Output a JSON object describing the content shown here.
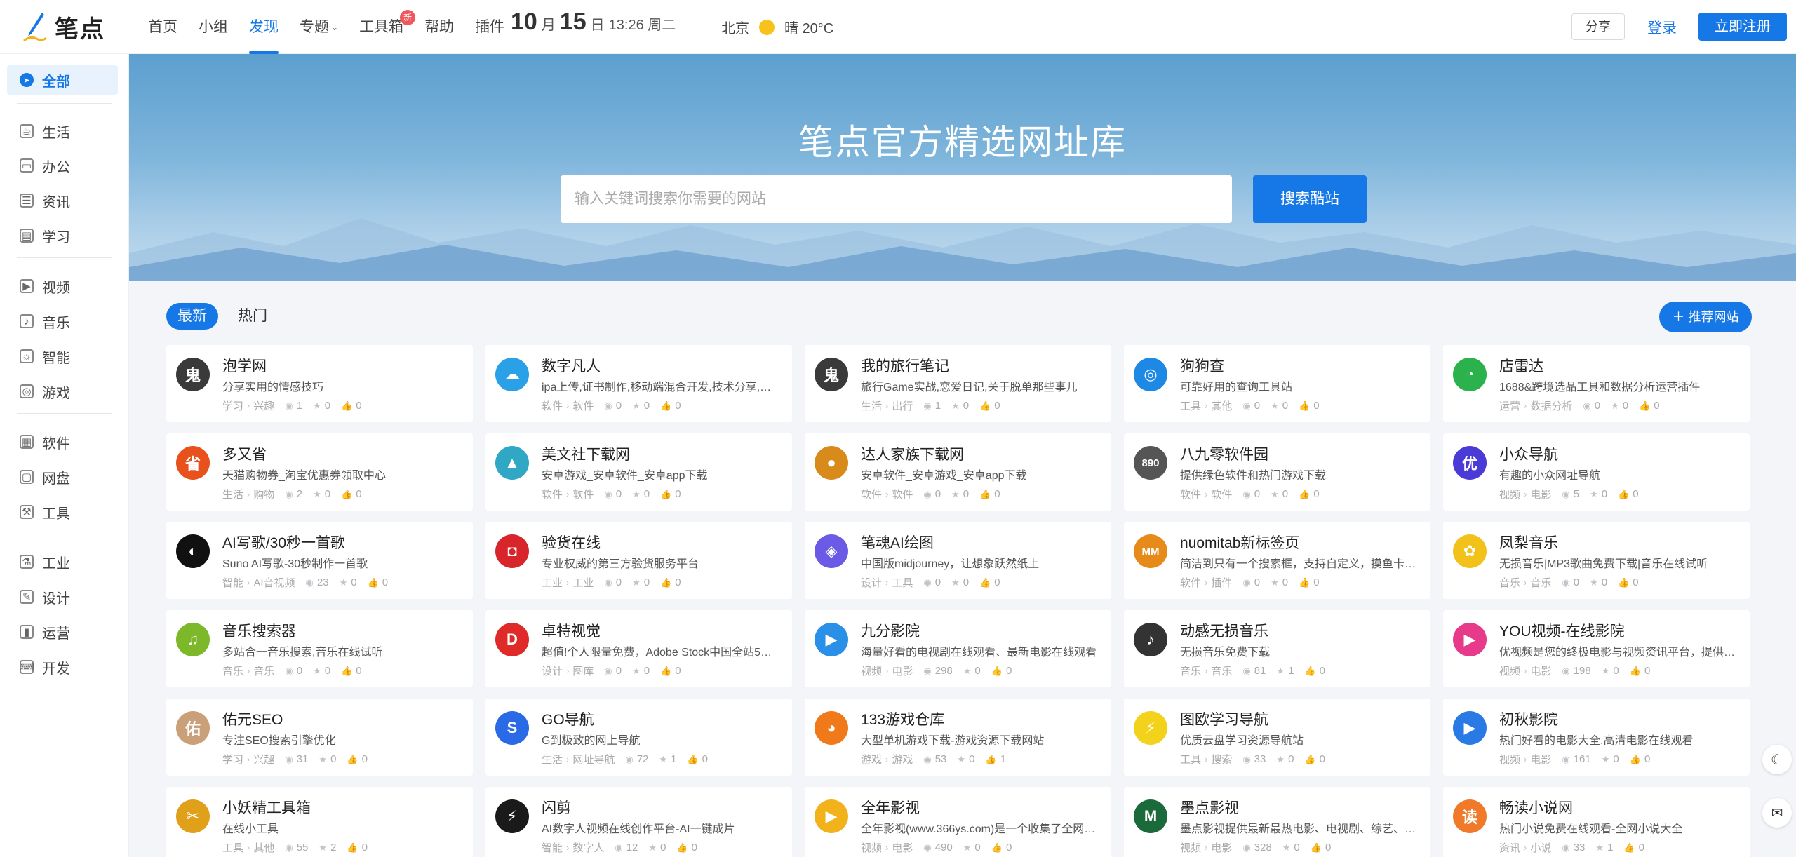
{
  "brand": {
    "name": "笔点"
  },
  "nav": [
    {
      "label": "首页",
      "active": false
    },
    {
      "label": "小组",
      "active": false
    },
    {
      "label": "发现",
      "active": true
    },
    {
      "label": "专题",
      "active": false,
      "caret": true
    },
    {
      "label": "工具箱",
      "active": false,
      "badge": "新"
    },
    {
      "label": "帮助",
      "active": false
    },
    {
      "label": "插件",
      "active": false
    }
  ],
  "date": {
    "month": "10",
    "month_label": "月",
    "day": "15",
    "day_label": "日",
    "rest": "13:26 周二"
  },
  "weather": {
    "city": "北京",
    "text": "晴 20°C"
  },
  "header_actions": {
    "share": "分享",
    "login": "登录",
    "register": "立即注册"
  },
  "sidebar": [
    {
      "label": "全部",
      "icon": "compass-icon",
      "active": true
    },
    {
      "label": "生活",
      "icon": "cup-icon"
    },
    {
      "label": "办公",
      "icon": "briefcase-icon"
    },
    {
      "label": "资讯",
      "icon": "news-icon"
    },
    {
      "label": "学习",
      "icon": "book-icon"
    },
    {
      "label": "视频",
      "icon": "video-icon"
    },
    {
      "label": "音乐",
      "icon": "music-icon"
    },
    {
      "label": "智能",
      "icon": "bulb-icon"
    },
    {
      "label": "游戏",
      "icon": "gamepad-icon"
    },
    {
      "label": "软件",
      "icon": "apps-icon"
    },
    {
      "label": "网盘",
      "icon": "folder-icon"
    },
    {
      "label": "工具",
      "icon": "hammer-icon"
    },
    {
      "label": "工业",
      "icon": "flask-icon"
    },
    {
      "label": "设计",
      "icon": "design-icon"
    },
    {
      "label": "运营",
      "icon": "chart-icon"
    },
    {
      "label": "开发",
      "icon": "code-icon"
    }
  ],
  "hero": {
    "title": "笔点官方精选网址库",
    "search_placeholder": "输入关键词搜索你需要的网站",
    "search_button": "搜索酷站"
  },
  "tabs": [
    {
      "label": "最新",
      "active": true
    },
    {
      "label": "热门",
      "active": false
    }
  ],
  "recommend_button": "＋ 推荐网站",
  "cards": [
    {
      "title": "泡学网",
      "desc": "分享实用的情感技巧",
      "cat": "学习",
      "sub": "兴趣",
      "views": "1",
      "stars": "0",
      "likes": "0",
      "logo_text": "鬼",
      "logo_color": "#3a3a3a"
    },
    {
      "title": "数字凡人",
      "desc": "ipa上传,证书制作,移动端混合开发,技术分享,…",
      "cat": "软件",
      "sub": "软件",
      "views": "0",
      "stars": "0",
      "likes": "0",
      "logo_text": "☁",
      "logo_color": "#2aa0e6"
    },
    {
      "title": "我的旅行笔记",
      "desc": "旅行Game实战,恋爱日记,关于脱单那些事儿",
      "cat": "生活",
      "sub": "出行",
      "views": "1",
      "stars": "0",
      "likes": "0",
      "logo_text": "鬼",
      "logo_color": "#3a3a3a"
    },
    {
      "title": "狗狗查",
      "desc": "可靠好用的查询工具站",
      "cat": "工具",
      "sub": "其他",
      "views": "0",
      "stars": "0",
      "likes": "0",
      "logo_text": "◎",
      "logo_color": "#1e88e5"
    },
    {
      "title": "店雷达",
      "desc": "1688&跨境选品工具和数据分析运营插件",
      "cat": "运营",
      "sub": "数据分析",
      "views": "0",
      "stars": "0",
      "likes": "0",
      "logo_text": "◔",
      "logo_color": "#2bb24c"
    },
    {
      "title": "多又省",
      "desc": "天猫购物券_淘宝优惠券领取中心",
      "cat": "生活",
      "sub": "购物",
      "views": "2",
      "stars": "0",
      "likes": "0",
      "logo_text": "省",
      "logo_color": "#e8511c"
    },
    {
      "title": "美文社下载网",
      "desc": "安卓游戏_安卓软件_安卓app下载",
      "cat": "软件",
      "sub": "软件",
      "views": "0",
      "stars": "0",
      "likes": "0",
      "logo_text": "▲",
      "logo_color": "#30a7c4"
    },
    {
      "title": "达人家族下载网",
      "desc": "安卓软件_安卓游戏_安卓app下载",
      "cat": "软件",
      "sub": "软件",
      "views": "0",
      "stars": "0",
      "likes": "0",
      "logo_text": "●",
      "logo_color": "#d88a1a"
    },
    {
      "title": "八九零软件园",
      "desc": "提供绿色软件和热门游戏下载",
      "cat": "软件",
      "sub": "软件",
      "views": "0",
      "stars": "0",
      "likes": "0",
      "logo_text": "890",
      "logo_color": "#555555"
    },
    {
      "title": "小众导航",
      "desc": "有趣的小众网址导航",
      "cat": "视频",
      "sub": "电影",
      "views": "5",
      "stars": "0",
      "likes": "0",
      "logo_text": "优",
      "logo_color": "#4a3ad6"
    },
    {
      "title": "AI写歌/30秒一首歌",
      "desc": "Suno AI写歌-30秒制作一首歌",
      "cat": "智能",
      "sub": "AI音视频",
      "views": "23",
      "stars": "0",
      "likes": "0",
      "logo_text": "◐",
      "logo_color": "#111111"
    },
    {
      "title": "验货在线",
      "desc": "专业权威的第三方验货服务平台",
      "cat": "工业",
      "sub": "工业",
      "views": "0",
      "stars": "0",
      "likes": "0",
      "logo_text": "◘",
      "logo_color": "#d8252b"
    },
    {
      "title": "笔魂AI绘图",
      "desc": "中国版midjourney，让想象跃然纸上",
      "cat": "设计",
      "sub": "工具",
      "views": "0",
      "stars": "0",
      "likes": "0",
      "logo_text": "◈",
      "logo_color": "#6a5ae6"
    },
    {
      "title": "nuomitab新标签页",
      "desc": "简洁到只有一个搜索框，支持自定义，摸鱼卡…",
      "cat": "软件",
      "sub": "插件",
      "views": "0",
      "stars": "0",
      "likes": "0",
      "logo_text": "MM",
      "logo_color": "#e68a1a"
    },
    {
      "title": "凤梨音乐",
      "desc": "无损音乐|MP3歌曲免费下载|音乐在线试听",
      "cat": "音乐",
      "sub": "音乐",
      "views": "0",
      "stars": "0",
      "likes": "0",
      "logo_text": "✿",
      "logo_color": "#f2c21b"
    },
    {
      "title": "音乐搜索器",
      "desc": "多站合一音乐搜索,音乐在线试听",
      "cat": "音乐",
      "sub": "音乐",
      "views": "0",
      "stars": "0",
      "likes": "0",
      "logo_text": "♫",
      "logo_color": "#7cb82a"
    },
    {
      "title": "卓特视觉",
      "desc": "超值!个人限量免费，Adobe Stock中国全站5…",
      "cat": "设计",
      "sub": "图库",
      "views": "0",
      "stars": "0",
      "likes": "0",
      "logo_text": "D",
      "logo_color": "#e02a2a"
    },
    {
      "title": "九分影院",
      "desc": "海量好看的电视剧在线观看、最新电影在线观看",
      "cat": "视频",
      "sub": "电影",
      "views": "298",
      "stars": "0",
      "likes": "0",
      "logo_text": "▶",
      "logo_color": "#2a8fe6"
    },
    {
      "title": "动感无损音乐",
      "desc": "无损音乐免费下载",
      "cat": "音乐",
      "sub": "音乐",
      "views": "81",
      "stars": "1",
      "likes": "0",
      "logo_text": "♪",
      "logo_color": "#333333"
    },
    {
      "title": "YOU视频-在线影院",
      "desc": "优视频是您的终极电影与视频资讯平台，提供…",
      "cat": "视频",
      "sub": "电影",
      "views": "198",
      "stars": "0",
      "likes": "0",
      "logo_text": "▶",
      "logo_color": "#e83a8a"
    },
    {
      "title": "佑元SEO",
      "desc": "专注SEO搜索引擎优化",
      "cat": "学习",
      "sub": "兴趣",
      "views": "31",
      "stars": "0",
      "likes": "0",
      "logo_text": "佑",
      "logo_color": "#c9a07a"
    },
    {
      "title": "GO导航",
      "desc": "G到极致的网上导航",
      "cat": "生活",
      "sub": "网址导航",
      "views": "72",
      "stars": "1",
      "likes": "0",
      "logo_text": "S",
      "logo_color": "#2a6ae6"
    },
    {
      "title": "133游戏仓库",
      "desc": "大型单机游戏下载-游戏资源下载网站",
      "cat": "游戏",
      "sub": "游戏",
      "views": "53",
      "stars": "0",
      "likes": "1",
      "logo_text": "◕",
      "logo_color": "#f07a1a"
    },
    {
      "title": "图欧学习导航",
      "desc": "优质云盘学习资源导航站",
      "cat": "工具",
      "sub": "搜索",
      "views": "33",
      "stars": "0",
      "likes": "0",
      "logo_text": "⚡",
      "logo_color": "#f2d21b"
    },
    {
      "title": "初秋影院",
      "desc": "热门好看的电影大全,高清电影在线观看",
      "cat": "视频",
      "sub": "电影",
      "views": "161",
      "stars": "0",
      "likes": "0",
      "logo_text": "▶",
      "logo_color": "#2a7ae6"
    },
    {
      "title": "小妖精工具箱",
      "desc": "在线小工具",
      "cat": "工具",
      "sub": "其他",
      "views": "55",
      "stars": "2",
      "likes": "0",
      "logo_text": "✂",
      "logo_color": "#e0a01a"
    },
    {
      "title": "闪剪",
      "desc": "AI数字人视频在线创作平台-AI一键成片",
      "cat": "智能",
      "sub": "数字人",
      "views": "12",
      "stars": "0",
      "likes": "0",
      "logo_text": "⚡",
      "logo_color": "#1a1a1a"
    },
    {
      "title": "全年影视",
      "desc": "全年影视(www.366ys.com)是一个收集了全网…",
      "cat": "视频",
      "sub": "电影",
      "views": "490",
      "stars": "0",
      "likes": "0",
      "logo_text": "▶",
      "logo_color": "#f2b21b"
    },
    {
      "title": "墨点影视",
      "desc": "墨点影视提供最新最热电影、电视剧、综艺、…",
      "cat": "视频",
      "sub": "电影",
      "views": "328",
      "stars": "0",
      "likes": "0",
      "logo_text": "M",
      "logo_color": "#1a6a3a"
    },
    {
      "title": "畅读小说网",
      "desc": "热门小说免费在线观看-全网小说大全",
      "cat": "资讯",
      "sub": "小说",
      "views": "33",
      "stars": "1",
      "likes": "0",
      "logo_text": "读",
      "logo_color": "#f07a2a"
    }
  ]
}
